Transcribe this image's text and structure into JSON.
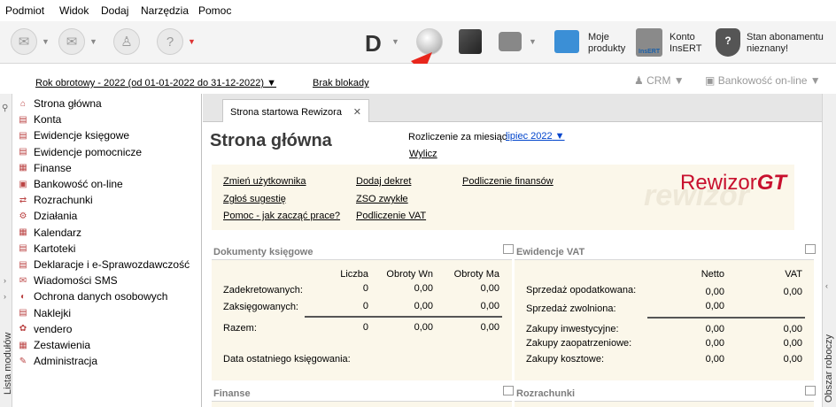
{
  "menu": [
    "Podmiot",
    "Widok",
    "Dodaj",
    "Narzędzia",
    "Pomoc"
  ],
  "toolbar": {
    "d_label": "D",
    "moje_produkty": "Moje\nprodukty",
    "konto": "Konto\nInsERT",
    "abonament": "Stan abonamentu\nnieznany!",
    "insert_badge": "InsERT"
  },
  "bar2": {
    "rok": "Rok obrotowy - 2022  (od 01-01-2022 do 31-12-2022)",
    "blokada": "Brak blokady",
    "crm": "CRM",
    "bank": "Bankowość on-line"
  },
  "sidebar": {
    "vertical_label": "Lista modułów",
    "items": [
      "Strona główna",
      "Konta",
      "Ewidencje księgowe",
      "Ewidencje pomocnicze",
      "Finanse",
      "Bankowość on-line",
      "Rozrachunki",
      "Działania",
      "Kalendarz",
      "Kartoteki",
      "Deklaracje i e-Sprawozdawczość",
      "Wiadomości SMS",
      "Ochrona danych osobowych",
      "Naklejki",
      "vendero",
      "Zestawienia",
      "Administracja"
    ]
  },
  "right_label": "Obszar roboczy",
  "tab": {
    "label": "Strona startowa Rewizora",
    "close": "✕"
  },
  "main": {
    "title": "Strona główna",
    "rozliczenie": "Rozliczenie za miesiąc",
    "miesiac": "lipiec 2022",
    "wylicz": "Wylicz",
    "links": [
      "Zmień użytkownika",
      "Zgłoś sugestię",
      "Pomoc - jak zacząć prace?",
      "Dodaj dekret",
      "ZSO zwykłe",
      "Podliczenie VAT",
      "Podliczenie finansów"
    ],
    "logo": "Rewizor",
    "logo_gt": "GT",
    "watermark": "rewizor"
  },
  "dok": {
    "header": "Dokumenty księgowe",
    "cols": [
      "Liczba",
      "Obroty Wn",
      "Obroty Ma"
    ],
    "rows": [
      {
        "label": "Zadekretowanych:",
        "v": [
          "0",
          "0,00",
          "0,00"
        ]
      },
      {
        "label": "Zaksięgowanych:",
        "v": [
          "0",
          "0,00",
          "0,00"
        ]
      },
      {
        "label": "Razem:",
        "v": [
          "0",
          "0,00",
          "0,00"
        ]
      }
    ],
    "ostatnie": "Data ostatniego księgowania:"
  },
  "vat": {
    "header": "Ewidencje VAT",
    "cols": [
      "Netto",
      "VAT"
    ],
    "rows": [
      {
        "label": "Sprzedaż opodatkowana:",
        "v": [
          "0,00",
          "0,00"
        ]
      },
      {
        "label": "Sprzedaż zwolniona:",
        "v": [
          "0,00",
          ""
        ]
      },
      {
        "label": "Zakupy inwestycyjne:",
        "v": [
          "0,00",
          "0,00"
        ]
      },
      {
        "label": "Zakupy zaopatrzeniowe:",
        "v": [
          "0,00",
          "0,00"
        ]
      },
      {
        "label": "Zakupy kosztowe:",
        "v": [
          "0,00",
          "0,00"
        ]
      }
    ]
  },
  "finanse": {
    "header": "Finanse"
  },
  "rozrachunki": {
    "header": "Rozrachunki"
  },
  "colors": {
    "accent": "#c8102e",
    "arrow": "#e8261c",
    "link": "#0044cc"
  }
}
